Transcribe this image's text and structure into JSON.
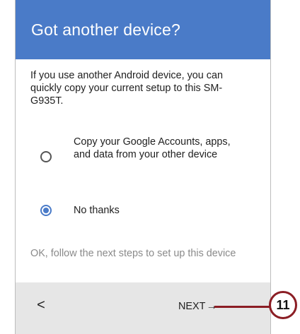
{
  "header": {
    "title": "Got another device?"
  },
  "intro_text": "If you use another Android device, you can quickly copy your current setup to this SM-G935T.",
  "options": [
    {
      "label": "Copy your Google Accounts, apps, and data from your other device",
      "selected": false
    },
    {
      "label": "No thanks",
      "selected": true
    }
  ],
  "footnote": "OK, follow the next steps to set up this device",
  "nav": {
    "back_label": "<",
    "next_label": "NEXT",
    "next_arrow": "→"
  },
  "callout": {
    "number": "11"
  },
  "colors": {
    "accent": "#4a7bc8",
    "callout": "#8b1d24"
  }
}
